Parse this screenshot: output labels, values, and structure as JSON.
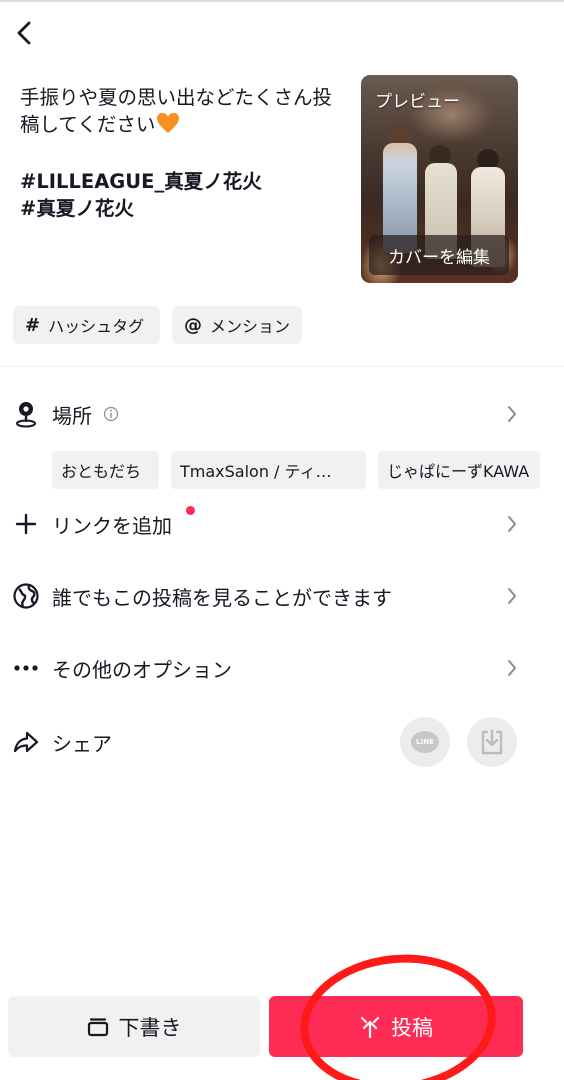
{
  "header": {
    "back_icon": "chevron-left-icon"
  },
  "caption": {
    "text": "手振りや夏の思い出などたくさん投稿してください",
    "emoji_icon": "orange-heart-icon",
    "hashtag_line1": "#LILLEAGUE_真夏ノ花火",
    "hashtag_line2": "#真夏ノ花火"
  },
  "preview": {
    "label": "プレビュー",
    "cover_edit_label": "カバーを編集"
  },
  "chips": [
    {
      "symbol": "#",
      "label": "ハッシュタグ"
    },
    {
      "symbol": "@",
      "label": "メンション"
    }
  ],
  "location": {
    "label": "場所",
    "icon": "location-pin-icon",
    "suggestions": [
      "おともだち",
      "TmaxSalon / ティ…",
      "じゃぱにーずKAWA"
    ]
  },
  "link": {
    "label": "リンクを追加",
    "icon": "plus-icon"
  },
  "privacy": {
    "label": "誰でもこの投稿を見ることができます",
    "icon": "globe-icon"
  },
  "more_options": {
    "label": "その他のオプション",
    "icon": "more-dots-icon"
  },
  "share": {
    "label": "シェア",
    "icon": "share-arrow-icon",
    "line_text": "LINE"
  },
  "footer": {
    "draft_label": "下書き",
    "post_label": "投稿"
  },
  "colors": {
    "accent": "#fe2c55",
    "annotation": "#ff1a1a"
  }
}
